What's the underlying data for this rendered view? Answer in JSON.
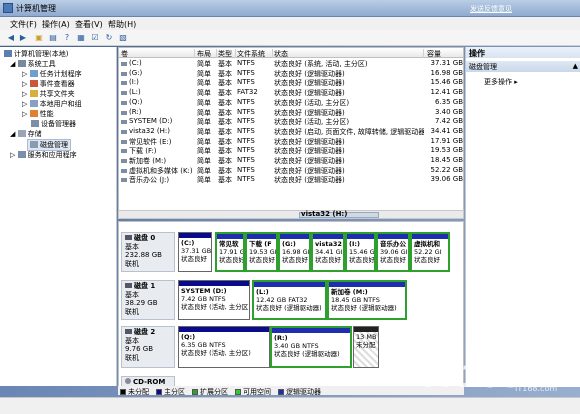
{
  "window": {
    "title": "计算机管理",
    "help_link": "发送反馈意见"
  },
  "menu": [
    "文件(F)",
    "操作(A)",
    "查看(V)",
    "帮助(H)"
  ],
  "tree": {
    "root": "计算机管理(本地)",
    "system_tools": "系统工具",
    "task_scheduler": "任务计划程序",
    "event_viewer": "事件查看器",
    "shared_folders": "共享文件夹",
    "local_users": "本地用户和组",
    "performance": "性能",
    "device_manager": "设备管理器",
    "storage": "存储",
    "disk_management": "磁盘管理",
    "services": "服务和应用程序"
  },
  "list": {
    "headers": [
      "卷",
      "布局",
      "类型",
      "文件系统",
      "状态",
      "容量"
    ],
    "rows": [
      [
        "(C:)",
        "简单",
        "基本",
        "NTFS",
        "状态良好 (系统, 活动, 主分区)",
        "37.31 GB"
      ],
      [
        "(G:)",
        "简单",
        "基本",
        "NTFS",
        "状态良好 (逻辑驱动器)",
        "16.98 GB"
      ],
      [
        "(I:)",
        "简单",
        "基本",
        "NTFS",
        "状态良好 (逻辑驱动器)",
        "15.46 GB"
      ],
      [
        "(L:)",
        "简单",
        "基本",
        "FAT32",
        "状态良好 (逻辑驱动器)",
        "12.41 GB"
      ],
      [
        "(Q:)",
        "简单",
        "基本",
        "NTFS",
        "状态良好 (活动, 主分区)",
        "6.35 GB"
      ],
      [
        "(R:)",
        "简单",
        "基本",
        "NTFS",
        "状态良好 (逻辑驱动器)",
        "3.40 GB"
      ],
      [
        "SYSTEM (D:)",
        "简单",
        "基本",
        "NTFS",
        "状态良好 (活动, 主分区)",
        "7.42 GB"
      ],
      [
        "vista32 (H:)",
        "简单",
        "基本",
        "NTFS",
        "状态良好 (启动, 页面文件, 故障转储, 逻辑驱动器)",
        "34.41 GB"
      ],
      [
        "常见软件 (E:)",
        "简单",
        "基本",
        "NTFS",
        "状态良好 (逻辑驱动器)",
        "17.91 GB"
      ],
      [
        "下载 (F:)",
        "简单",
        "基本",
        "NTFS",
        "状态良好 (逻辑驱动器)",
        "19.53 GB"
      ],
      [
        "新加卷 (M:)",
        "简单",
        "基本",
        "NTFS",
        "状态良好 (逻辑驱动器)",
        "18.45 GB"
      ],
      [
        "虚拟机和多媒体 (K:)",
        "简单",
        "基本",
        "NTFS",
        "状态良好 (逻辑驱动器)",
        "52.22 GB"
      ],
      [
        "音乐办公 (J:)",
        "简单",
        "基本",
        "NTFS",
        "状态良好 (逻辑驱动器)",
        "39.06 GB"
      ]
    ]
  },
  "scroll_label": "vista32 (H:)",
  "disks": [
    {
      "name": "磁盘 0",
      "type": "基本",
      "size": "232.88 GB",
      "status": "联机",
      "parts": [
        {
          "name": "(C:)",
          "size": "37.31 GB",
          "status": "状态良好"
        },
        {
          "name": "常见软",
          "size": "17.91 G",
          "status": "状态良好"
        },
        {
          "name": "下载 (F",
          "size": "19.53 GI",
          "status": "状态良好"
        },
        {
          "name": "(G:)",
          "size": "16.98 GI",
          "status": "状态良好"
        },
        {
          "name": "vista32",
          "size": "34.41 GI",
          "status": "状态良好"
        },
        {
          "name": "(I:)",
          "size": "15.46 G",
          "status": "状态良好"
        },
        {
          "name": "音乐办公",
          "size": "39.06 GI",
          "status": "状态良好"
        },
        {
          "name": "虚拟机和",
          "size": "52.22 GI",
          "status": "状态良好"
        }
      ]
    },
    {
      "name": "磁盘 1",
      "type": "基本",
      "size": "38.29 GB",
      "status": "联机",
      "parts": [
        {
          "name": "SYSTEM  (D:)",
          "size": "7.42 GB NTFS",
          "status": "状态良好 (活动, 主分区)"
        },
        {
          "name": "(L:)",
          "size": "12.42 GB FAT32",
          "status": "状态良好 (逻辑驱动器)"
        },
        {
          "name": "新加卷  (M:)",
          "size": "18.45 GB NTFS",
          "status": "状态良好 (逻辑驱动器)"
        }
      ]
    },
    {
      "name": "磁盘 2",
      "type": "基本",
      "size": "9.76 GB",
      "status": "联机",
      "parts": [
        {
          "name": "(Q:)",
          "size": "6.35 GB NTFS",
          "status": "状态良好 (活动, 主分区)"
        },
        {
          "name": "(R:)",
          "size": "3.40 GB NTFS",
          "status": "状态良好 (逻辑驱动器)"
        },
        {
          "name": "",
          "size": "13 MB",
          "status": "未分配"
        }
      ]
    },
    {
      "name": "CD-ROM 0"
    }
  ],
  "legend": [
    "未分配",
    "主分区",
    "扩展分区",
    "可用空间",
    "逻辑驱动器"
  ],
  "legend_colors": [
    "#000000",
    "#0a0a8c",
    "#2ea02e",
    "#34c834",
    "#1d2fae"
  ],
  "ops": {
    "title": "操作",
    "section": "磁盘管理",
    "more": "更多操作"
  },
  "watermark": "IT168.com"
}
